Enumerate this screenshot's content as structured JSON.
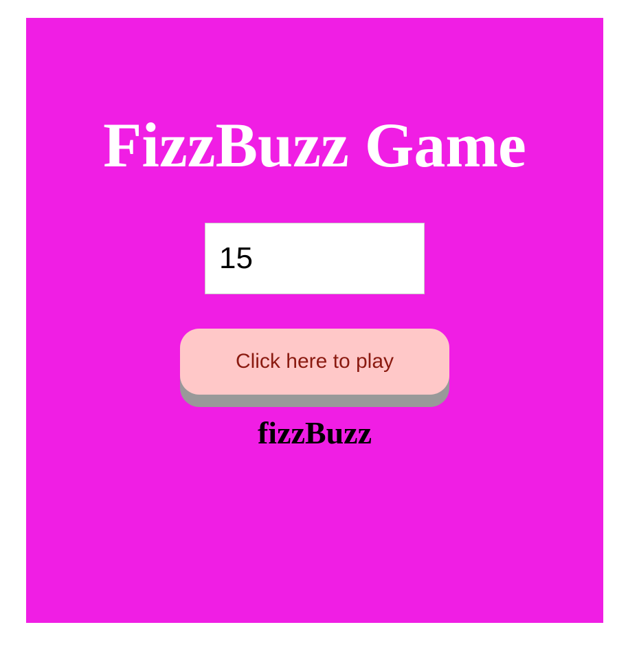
{
  "page": {
    "title": "FizzBuzz Game",
    "colors": {
      "panel_background": "#f01ee4",
      "title_text": "#ffffff",
      "button_background": "#ffc8c8",
      "button_text": "#8a1a10",
      "button_shadow": "#999999"
    }
  },
  "input": {
    "value": "15"
  },
  "play_button": {
    "label": "Click here to play"
  },
  "result": {
    "text": "fizzBuzz"
  }
}
